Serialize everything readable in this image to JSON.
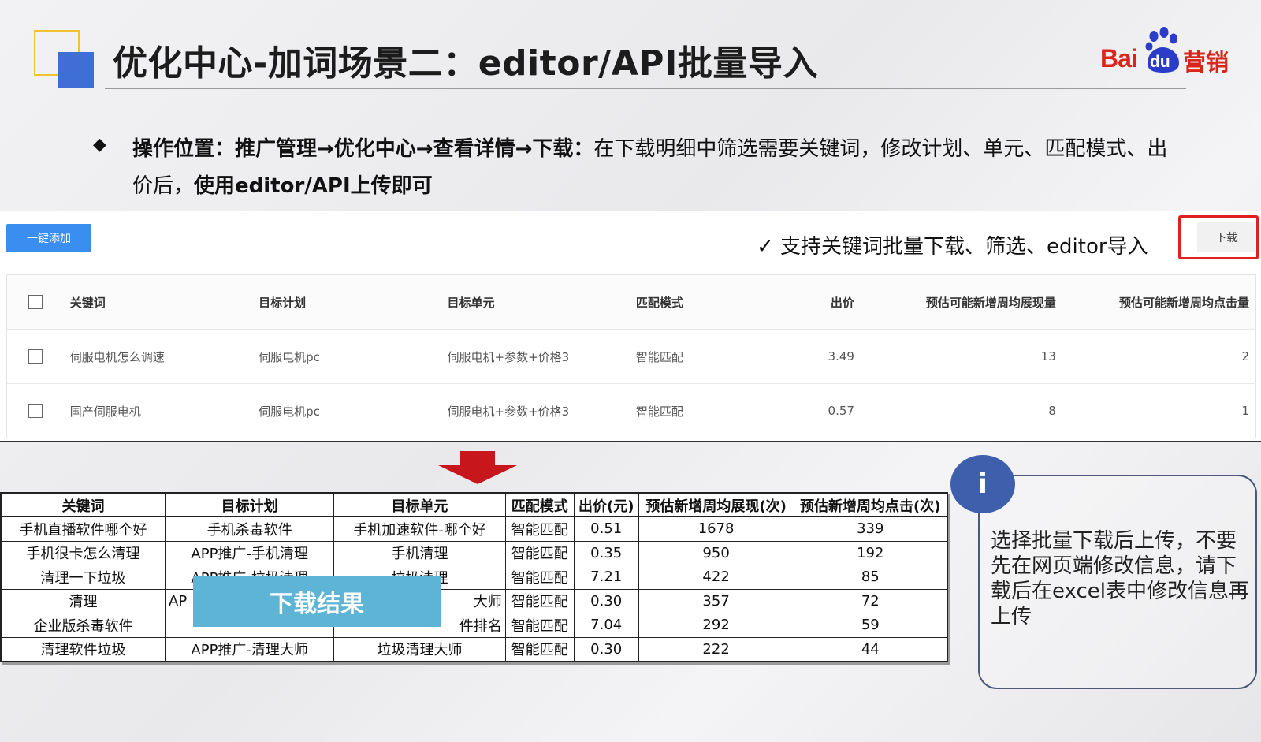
{
  "header": {
    "title": "优化中心-加词场景二：editor/API批量导入",
    "logo": {
      "bai": "Bai",
      "du": "du",
      "brand_suffix": "营销"
    }
  },
  "instruction": {
    "bullet_icon": "◆",
    "bold_path": "操作位置：推广管理→优化中心→查看详情→下载：",
    "normal_text": "在下载明细中筛选需要关键词，修改计划、单元、匹配模式、出价后，",
    "bold_tail": "使用editor/API上传即可"
  },
  "app_panel": {
    "add_button": "一键添加",
    "support_note": "✓ 支持关键词批量下载、筛选、editor导入",
    "download_button": "下载",
    "table": {
      "headers": [
        "关键词",
        "目标计划",
        "目标单元",
        "匹配模式",
        "出价",
        "预估可能新增周均展现量",
        "预估可能新增周均点击量"
      ],
      "rows": [
        [
          "伺服电机怎么调速",
          "伺服电机pc",
          "伺服电机+参数+价格3",
          "智能匹配",
          "3.49",
          "13",
          "2"
        ],
        [
          "国产伺服电机",
          "伺服电机pc",
          "伺服电机+参数+价格3",
          "智能匹配",
          "0.57",
          "8",
          "1"
        ]
      ]
    }
  },
  "result": {
    "label": "下载结果",
    "headers": [
      "关键词",
      "目标计划",
      "目标单元",
      "匹配模式",
      "出价(元)",
      "预估新增周均展现(次)",
      "预估新增周均点击(次)"
    ],
    "rows": [
      [
        "手机直播软件哪个好",
        "手机杀毒软件",
        "手机加速软件-哪个好",
        "智能匹配",
        "0.51",
        "1678",
        "339"
      ],
      [
        "手机很卡怎么清理",
        "APP推广-手机清理",
        "手机清理",
        "智能匹配",
        "0.35",
        "950",
        "192"
      ],
      [
        "清理一下垃圾",
        "APP推广-垃圾清理",
        "垃圾清理",
        "智能匹配",
        "7.21",
        "422",
        "85"
      ],
      [
        "清理",
        "AP",
        "大师",
        "智能匹配",
        "0.30",
        "357",
        "72"
      ],
      [
        "企业版杀毒软件",
        "",
        "件排名",
        "智能匹配",
        "7.04",
        "292",
        "59"
      ],
      [
        "清理软件垃圾",
        "APP推广-清理大师",
        "垃圾清理大师",
        "智能匹配",
        "0.30",
        "222",
        "44"
      ]
    ]
  },
  "info": {
    "icon": "i",
    "text": "选择批量下载后上传，不要先在网页端修改信息，请下载后在excel表中修改信息再上传"
  },
  "colors": {
    "accent_blue": "#3a8ef0",
    "highlight_red": "#e02020",
    "arrow_red": "#c8161d",
    "label_blue": "#5eb4d4",
    "info_blue": "#3e5fab"
  }
}
